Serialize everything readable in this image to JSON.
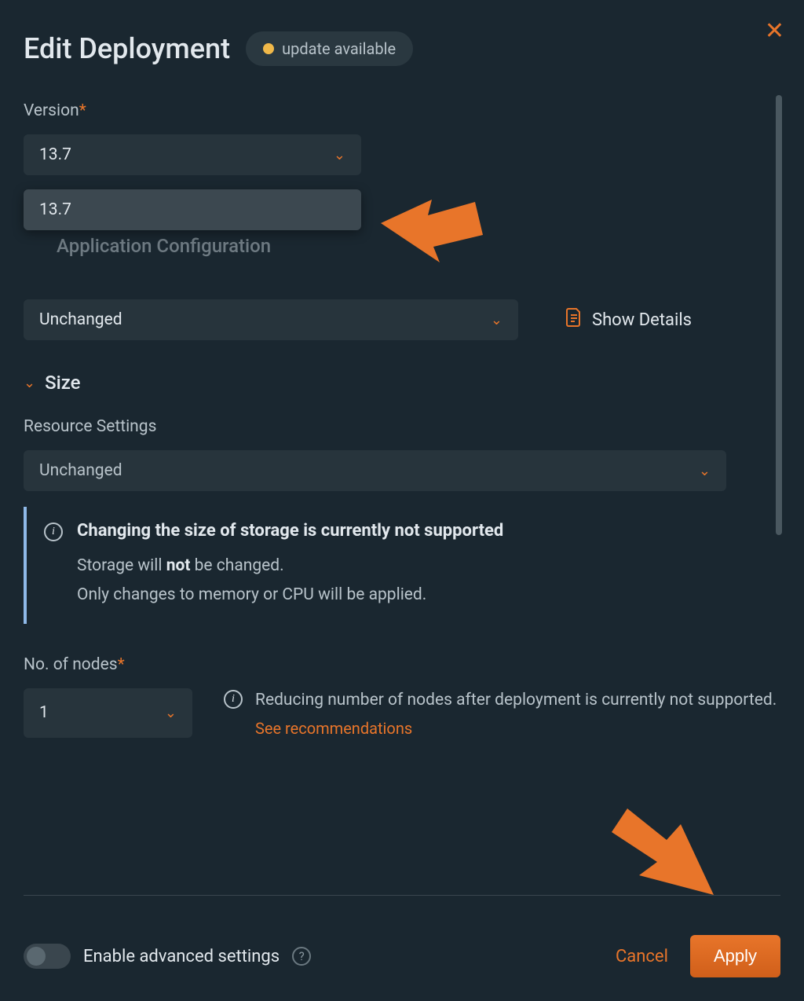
{
  "dialog": {
    "title": "Edit Deployment",
    "badge": "update available"
  },
  "version": {
    "label": "Version",
    "selected": "13.7",
    "option": "13.7"
  },
  "appConfig": {
    "selected": "Unchanged",
    "showDetails": "Show Details"
  },
  "size": {
    "section": "Size",
    "resourceLabel": "Resource Settings",
    "resourceSelected": "Unchanged"
  },
  "info": {
    "title": "Changing the size of storage is currently not supported",
    "line1a": "Storage will ",
    "line1b": "not",
    "line1c": " be changed.",
    "line2": "Only changes to memory or CPU will be applied."
  },
  "nodes": {
    "label": "No. of nodes",
    "value": "1",
    "warning": "Reducing number of nodes after deployment is currently not supported.",
    "link": "See recommendations"
  },
  "footer": {
    "toggle": "Enable advanced settings",
    "cancel": "Cancel",
    "apply": "Apply"
  }
}
